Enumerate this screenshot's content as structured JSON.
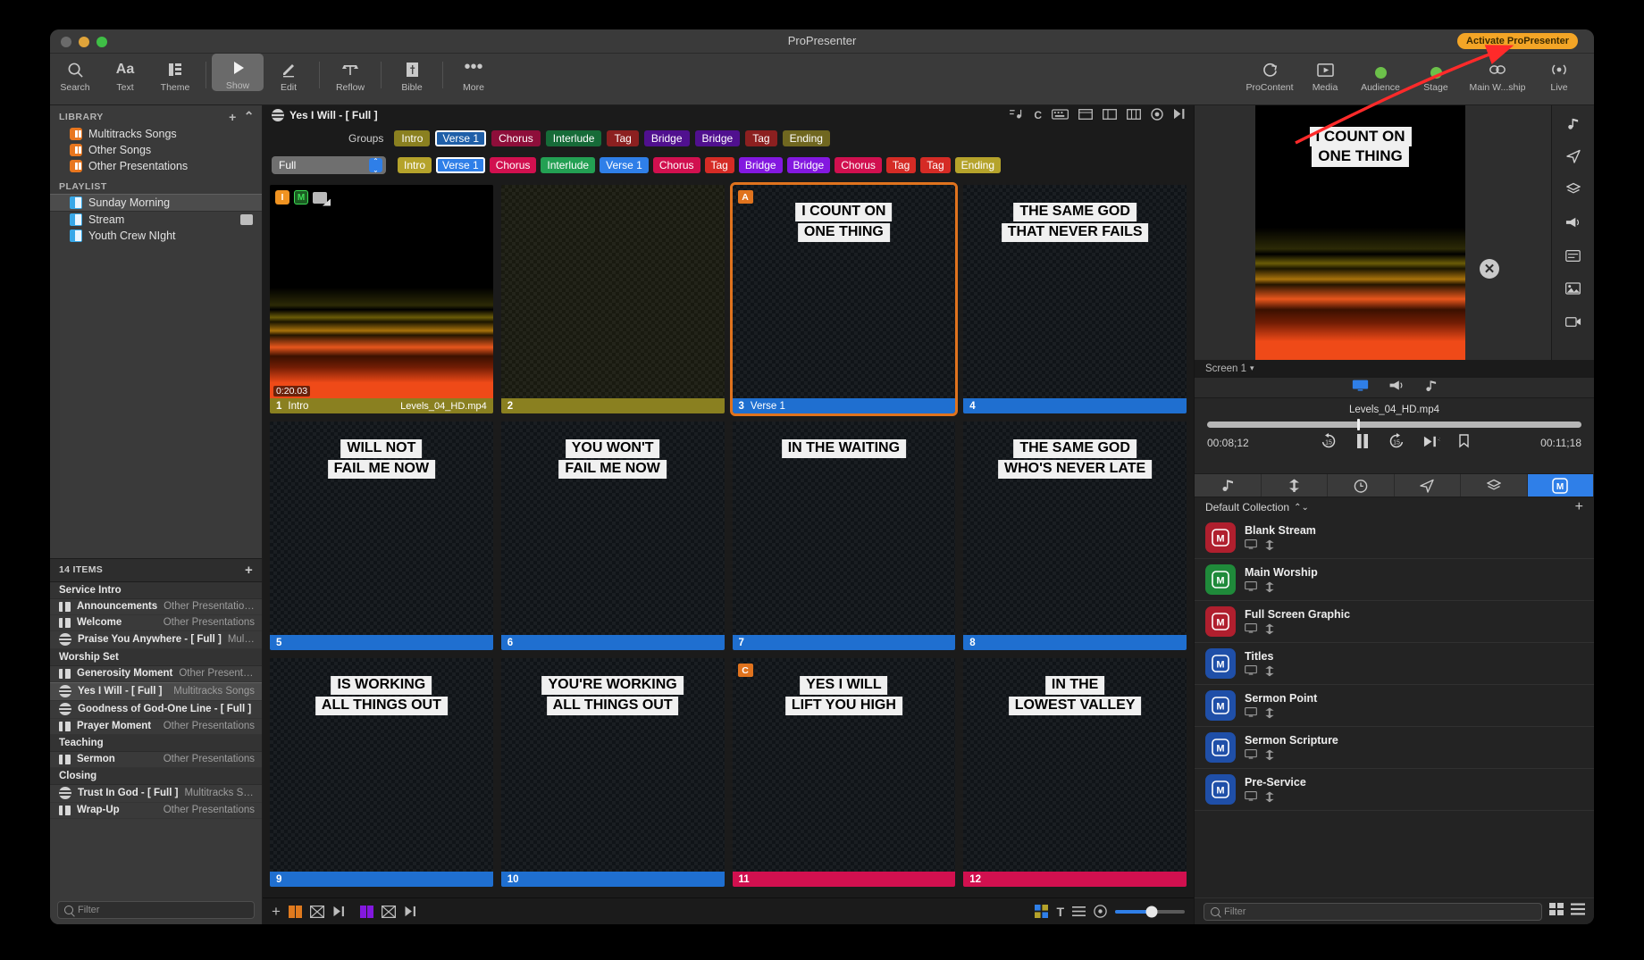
{
  "window": {
    "title": "ProPresenter",
    "activate_badge": "Activate ProPresenter"
  },
  "toolbar": {
    "left_items": [
      {
        "label": "Search",
        "icon": "search-icon"
      },
      {
        "label": "Text",
        "icon": "text-icon"
      },
      {
        "label": "Theme",
        "icon": "theme-icon"
      },
      {
        "label": "Show",
        "icon": "play-icon"
      },
      {
        "label": "Edit",
        "icon": "pencil-icon"
      },
      {
        "label": "Reflow",
        "icon": "reflow-icon"
      },
      {
        "label": "Bible",
        "icon": "bible-icon"
      },
      {
        "label": "More",
        "icon": "ellipsis-icon"
      }
    ],
    "right_items": [
      {
        "label": "ProContent",
        "icon": "procontent-icon"
      },
      {
        "label": "Media",
        "icon": "media-icon"
      },
      {
        "label": "Audience",
        "icon": "status-dot-icon"
      },
      {
        "label": "Stage",
        "icon": "status-dot-icon"
      },
      {
        "label": "Main W...ship",
        "icon": "link-icon"
      },
      {
        "label": "Live",
        "icon": "broadcast-icon"
      }
    ]
  },
  "sidebar": {
    "library_header": "LIBRARY",
    "library_items": [
      {
        "label": "Multitracks Songs"
      },
      {
        "label": "Other Songs"
      },
      {
        "label": "Other Presentations"
      }
    ],
    "playlist_header": "PLAYLIST",
    "playlist_items": [
      {
        "label": "Sunday Morning",
        "selected": true,
        "badge": false
      },
      {
        "label": "Stream",
        "selected": false,
        "badge": true
      },
      {
        "label": "Youth Crew NIght",
        "selected": false,
        "badge": false
      }
    ],
    "items_count": "14 ITEMS",
    "groups": [
      {
        "title": "Service Intro",
        "items": [
          {
            "name": "Announcements",
            "source": "Other Presentations",
            "type": "presentation",
            "selected": false
          },
          {
            "name": "Welcome",
            "source": "Other Presentations",
            "type": "presentation",
            "selected": false
          },
          {
            "name": "Praise You Anywhere - [ Full ]",
            "source": "Multitr...",
            "type": "song",
            "selected": false
          }
        ]
      },
      {
        "title": "Worship Set",
        "items": [
          {
            "name": "Generosity Moment",
            "source": "Other Presentati...",
            "type": "presentation",
            "selected": false
          },
          {
            "name": "Yes I Will - [ Full ]",
            "source": "Multitracks Songs",
            "type": "song",
            "selected": true
          },
          {
            "name": "Goodness of God-One Line - [ Full ]",
            "source": "...",
            "type": "song",
            "selected": false
          },
          {
            "name": "Prayer Moment",
            "source": "Other Presentations",
            "type": "presentation",
            "selected": false
          }
        ]
      },
      {
        "title": "Teaching",
        "items": [
          {
            "name": "Sermon",
            "source": "Other Presentations",
            "type": "presentation",
            "selected": false
          }
        ]
      },
      {
        "title": "Closing",
        "items": [
          {
            "name": "Trust In God - [ Full ]",
            "source": "Multitracks Songs",
            "type": "song",
            "selected": false
          },
          {
            "name": "Wrap-Up",
            "source": "Other Presentations",
            "type": "presentation",
            "selected": false
          }
        ]
      }
    ],
    "filter_placeholder": "Filter"
  },
  "document": {
    "title": "Yes I Will - [ Full ]",
    "groups_label": "Groups",
    "groups": [
      {
        "label": "Intro",
        "color": "#8a8020",
        "selected": false
      },
      {
        "label": "Verse 1",
        "color": "#1f5fa8",
        "selected": true
      },
      {
        "label": "Chorus",
        "color": "#8e0e3a",
        "selected": false
      },
      {
        "label": "Interlude",
        "color": "#166b38",
        "selected": false
      },
      {
        "label": "Tag",
        "color": "#8c2020",
        "selected": false
      },
      {
        "label": "Bridge",
        "color": "#50108f",
        "selected": false
      },
      {
        "label": "Bridge",
        "color": "#50108f",
        "selected": false
      },
      {
        "label": "Tag",
        "color": "#8c2020",
        "selected": false
      },
      {
        "label": "Ending",
        "color": "#706720",
        "selected": false
      }
    ],
    "arrangement_name": "Full",
    "arrangement": [
      {
        "label": "Intro",
        "color": "#b5a32b",
        "selected": false
      },
      {
        "label": "Verse 1",
        "color": "#2f7fe8",
        "selected": true
      },
      {
        "label": "Chorus",
        "color": "#d1104f",
        "selected": false
      },
      {
        "label": "Interlude",
        "color": "#23a053",
        "selected": false
      },
      {
        "label": "Verse 1",
        "color": "#2f7fe8",
        "selected": false
      },
      {
        "label": "Chorus",
        "color": "#d1104f",
        "selected": false
      },
      {
        "label": "Tag",
        "color": "#d52b25",
        "selected": false
      },
      {
        "label": "Bridge",
        "color": "#8318e0",
        "selected": false
      },
      {
        "label": "Bridge",
        "color": "#8318e0",
        "selected": false
      },
      {
        "label": "Chorus",
        "color": "#d1104f",
        "selected": false
      },
      {
        "label": "Tag",
        "color": "#d52b25",
        "selected": false
      },
      {
        "label": "Tag",
        "color": "#d52b25",
        "selected": false
      },
      {
        "label": "Ending",
        "color": "#b5a32b",
        "selected": false
      }
    ]
  },
  "slides": [
    {
      "number": "1",
      "label": "Intro",
      "footer_color": "#8a8020",
      "lines": [],
      "style": "levels",
      "duration": "0:20.03",
      "file": "Levels_04_HD.mp4",
      "badges": [
        "I",
        "M",
        "media"
      ],
      "active": false,
      "corner": null
    },
    {
      "number": "2",
      "label": "",
      "footer_color": "#8a8020",
      "lines": [],
      "style": "olive",
      "duration": null,
      "file": null,
      "badges": [],
      "active": false,
      "corner": null
    },
    {
      "number": "3",
      "label": "Verse 1",
      "footer_color": "#1f6fd0",
      "lines": [
        "I COUNT ON",
        "ONE THING"
      ],
      "style": "navy",
      "duration": null,
      "file": null,
      "badges": [],
      "active": true,
      "corner": {
        "text": "A",
        "color": "#e0731e"
      }
    },
    {
      "number": "4",
      "label": "",
      "footer_color": "#1f6fd0",
      "lines": [
        "THE SAME GOD",
        "THAT NEVER FAILS"
      ],
      "style": "navy",
      "duration": null,
      "file": null,
      "badges": [],
      "active": false,
      "corner": null
    },
    {
      "number": "5",
      "label": "",
      "footer_color": "#1f6fd0",
      "lines": [
        "WILL NOT",
        "FAIL ME NOW"
      ],
      "style": "navy",
      "duration": null,
      "file": null,
      "badges": [],
      "active": false,
      "corner": null
    },
    {
      "number": "6",
      "label": "",
      "footer_color": "#1f6fd0",
      "lines": [
        "YOU WON'T",
        "FAIL ME NOW"
      ],
      "style": "navy",
      "duration": null,
      "file": null,
      "badges": [],
      "active": false,
      "corner": null
    },
    {
      "number": "7",
      "label": "",
      "footer_color": "#1f6fd0",
      "lines": [
        "IN THE WAITING"
      ],
      "style": "navy",
      "duration": null,
      "file": null,
      "badges": [],
      "active": false,
      "corner": null
    },
    {
      "number": "8",
      "label": "",
      "footer_color": "#1f6fd0",
      "lines": [
        "THE SAME GOD",
        "WHO'S NEVER LATE"
      ],
      "style": "navy",
      "duration": null,
      "file": null,
      "badges": [],
      "active": false,
      "corner": null
    },
    {
      "number": "9",
      "label": "",
      "footer_color": "#1f6fd0",
      "lines": [
        "IS WORKING",
        "ALL THINGS OUT"
      ],
      "style": "navy",
      "duration": null,
      "file": null,
      "badges": [],
      "active": false,
      "corner": null
    },
    {
      "number": "10",
      "label": "",
      "footer_color": "#1f6fd0",
      "lines": [
        "YOU'RE WORKING",
        "ALL THINGS OUT"
      ],
      "style": "navy",
      "duration": null,
      "file": null,
      "badges": [],
      "active": false,
      "corner": null
    },
    {
      "number": "11",
      "label": "",
      "footer_color": "#d1104f",
      "lines": [
        "YES I WILL",
        "LIFT YOU HIGH"
      ],
      "style": "navy",
      "duration": null,
      "file": null,
      "badges": [],
      "active": false,
      "corner": {
        "text": "C",
        "color": "#e0731e"
      }
    },
    {
      "number": "12",
      "label": "",
      "footer_color": "#d1104f",
      "lines": [
        "IN THE",
        "LOWEST VALLEY"
      ],
      "style": "navy",
      "duration": null,
      "file": null,
      "badges": [],
      "active": false,
      "corner": null
    }
  ],
  "preview": {
    "lines": [
      "I COUNT ON",
      "ONE THING"
    ],
    "screen_label": "Screen 1"
  },
  "transport": {
    "media_name": "Levels_04_HD.mp4",
    "elapsed": "00:08;12",
    "remaining": "00:11;18",
    "skip_back_label": "15",
    "progress_percent": 40
  },
  "collection": {
    "name": "Default Collection",
    "looks": [
      {
        "name": "Blank Stream",
        "color": "#b01f2e",
        "glyph": "M"
      },
      {
        "name": "Main Worship",
        "color": "#1f8a3a",
        "glyph": "M"
      },
      {
        "name": "Full Screen Graphic",
        "color": "#b01f2e",
        "glyph": "M"
      },
      {
        "name": "Titles",
        "color": "#1f4fa8",
        "glyph": "M"
      },
      {
        "name": "Sermon Point",
        "color": "#1f4fa8",
        "glyph": "M"
      },
      {
        "name": "Sermon Scripture",
        "color": "#1f4fa8",
        "glyph": "M"
      },
      {
        "name": "Pre-Service",
        "color": "#1f4fa8",
        "glyph": "M"
      }
    ],
    "filter_placeholder": "Filter"
  },
  "colors": {
    "accent": "#2f7fe8",
    "active_outline": "#e0731e",
    "annotation_arrow": "#ff2a2a"
  }
}
